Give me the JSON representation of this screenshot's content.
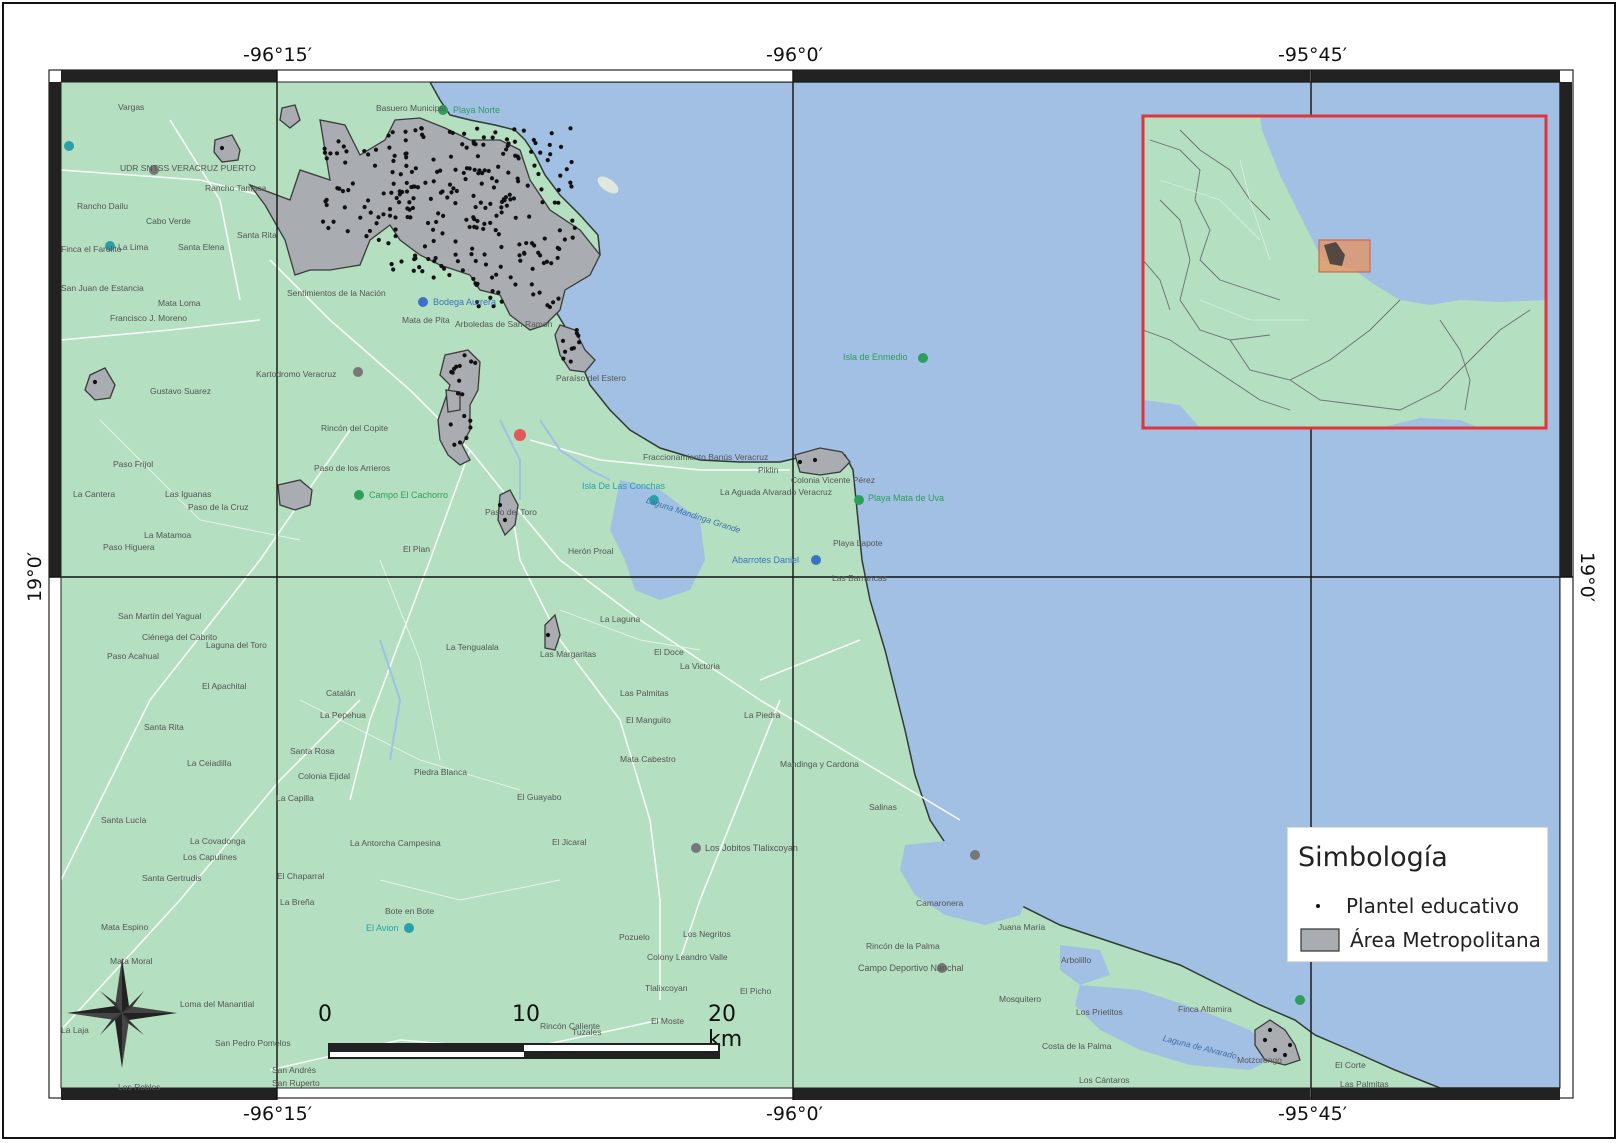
{
  "map": {
    "grid_labels": {
      "top": [
        "-96°15′",
        "-96°0′",
        "-95°45′"
      ],
      "bottom": [
        "-96°15′",
        "-96°0′",
        "-95°45′"
      ],
      "left": [
        "19°0′"
      ],
      "right": [
        "19°0′"
      ]
    },
    "colors": {
      "land": "#b4dfc0",
      "water": "#a1c0e4",
      "metro_area": "#a9acb1",
      "points": "#111111",
      "inset_border": "#e0353a",
      "inset_highlight": "#e9925f",
      "frame": "#222222"
    },
    "places": [
      {
        "name": "Vargas"
      },
      {
        "name": "UDR SNTSS VERACRUZ PUERTO"
      },
      {
        "name": "Rancho Tamaca"
      },
      {
        "name": "Rancho Dailu"
      },
      {
        "name": "Cabo Verde"
      },
      {
        "name": "Finca el Farolito"
      },
      {
        "name": "La Lima"
      },
      {
        "name": "Santa Elena"
      },
      {
        "name": "Santa Rita"
      },
      {
        "name": "San Juan de Estancia"
      },
      {
        "name": "Mata Loma"
      },
      {
        "name": "Francisco J. Moreno"
      },
      {
        "name": "Gustavo Suarez"
      },
      {
        "name": "Paso Frijol"
      },
      {
        "name": "La Cantera"
      },
      {
        "name": "Las Iguanas"
      },
      {
        "name": "Paso de la Cruz"
      },
      {
        "name": "La Matamoa"
      },
      {
        "name": "Paso Higuera"
      },
      {
        "name": "Basuero Municipal"
      },
      {
        "name": "Sentimientos de la Nación"
      },
      {
        "name": "Mata de Pita"
      },
      {
        "name": "Arboledas de San Ramon"
      },
      {
        "name": "Kartodromo Veracruz"
      },
      {
        "name": "Rincón del Copite"
      },
      {
        "name": "Paso de los Arrieros"
      },
      {
        "name": "Paraíso del Estero"
      },
      {
        "name": "Paso del Toro"
      },
      {
        "name": "El Plan"
      },
      {
        "name": "Herón Proal"
      },
      {
        "name": "Fraccionamiento Banús Veracruz"
      },
      {
        "name": "Piklin"
      },
      {
        "name": "La Aguada Alvarado Veracruz"
      },
      {
        "name": "Colonia Vicente Pérez"
      },
      {
        "name": "Playa Lapote"
      },
      {
        "name": "Las Barrancas"
      },
      {
        "name": "San Martín del Yagual"
      },
      {
        "name": "Ciénega del Cabrito"
      },
      {
        "name": "Laguna del Toro"
      },
      {
        "name": "Paso Acahual"
      },
      {
        "name": "El Apachital"
      },
      {
        "name": "Catalán"
      },
      {
        "name": "La Pepehua"
      },
      {
        "name": "Santa Rita"
      },
      {
        "name": "Santa Rosa"
      },
      {
        "name": "La Ceiadilla"
      },
      {
        "name": "Colonia Ejidal"
      },
      {
        "name": "Piedra Blanca"
      },
      {
        "name": "La Capilla"
      },
      {
        "name": "Santa Lucía"
      },
      {
        "name": "La Covadonga"
      },
      {
        "name": "Los Capulines"
      },
      {
        "name": "Santa Gertrudis"
      },
      {
        "name": "El Chaparral"
      },
      {
        "name": "La Breña"
      },
      {
        "name": "La Antorcha Campesina"
      },
      {
        "name": "El Guayabo"
      },
      {
        "name": "El Jicaral"
      },
      {
        "name": "Mata Espino"
      },
      {
        "name": "Mata Moral"
      },
      {
        "name": "Loma del Manantial"
      },
      {
        "name": "La Laja"
      },
      {
        "name": "San Pedro Pomelos"
      },
      {
        "name": "San Andrés"
      },
      {
        "name": "San Ruperto"
      },
      {
        "name": "Los Robles"
      },
      {
        "name": "Bote en Bote"
      },
      {
        "name": "La Tengualala"
      },
      {
        "name": "Las Margaritas"
      },
      {
        "name": "La Laguna"
      },
      {
        "name": "El Doce"
      },
      {
        "name": "La Victoria"
      },
      {
        "name": "Las Palmitas"
      },
      {
        "name": "El Manguito"
      },
      {
        "name": "La Piedra"
      },
      {
        "name": "Mata Cabestro"
      },
      {
        "name": "Mandinga y Cardona"
      },
      {
        "name": "Salinas"
      },
      {
        "name": "Pozuelo"
      },
      {
        "name": "Colony Leandro Valle"
      },
      {
        "name": "Tlalixcoyan"
      },
      {
        "name": "Los Negritos"
      },
      {
        "name": "El Picho"
      },
      {
        "name": "El Moste"
      },
      {
        "name": "Rincón Caliente"
      },
      {
        "name": "Tuzales"
      },
      {
        "name": "Rincón de la Palma"
      },
      {
        "name": "Juana María"
      },
      {
        "name": "Arbolillo"
      },
      {
        "name": "Mosquitero"
      },
      {
        "name": "Los Prietitos"
      },
      {
        "name": "Costa de la Palma"
      },
      {
        "name": "Finca Altamira"
      },
      {
        "name": "Motzorongo"
      },
      {
        "name": "El Corte"
      },
      {
        "name": "Los Cántaros"
      },
      {
        "name": "Las Palmitas"
      },
      {
        "name": "Camaronera"
      },
      {
        "name": "Laguna de Alvarado"
      },
      {
        "name": "Laguna Mandinga Grande"
      }
    ],
    "pois": [
      {
        "name": "Playa Norte",
        "color": "#2e9e5b"
      },
      {
        "name": "Bodega Aurrera",
        "color": "#3b73c4"
      },
      {
        "name": "Isla de Enmedio",
        "color": "#2e9e5b"
      },
      {
        "name": "Isla De Las Conchas",
        "color": "#2aa0a8"
      },
      {
        "name": "Campo El Cachorro",
        "color": "#2e9e5b"
      },
      {
        "name": "Playa Mata de Uva",
        "color": "#2e9e5b"
      },
      {
        "name": "Abarrotes Daniel",
        "color": "#3b73c4"
      },
      {
        "name": "Los Jobitos Tlalixcoyan",
        "color": "#555555"
      },
      {
        "name": "El Avion",
        "color": "#2aa0a8"
      },
      {
        "name": "Campo Deportivo Nanchal",
        "color": "#555555"
      }
    ]
  },
  "legend": {
    "title": "Simbología",
    "items": [
      {
        "label": "Plantel educativo",
        "symbol": "point"
      },
      {
        "label": "Área Metropolitana",
        "symbol": "polygon"
      }
    ]
  },
  "scale_bar": {
    "labels": [
      "0",
      "10",
      "20 km"
    ]
  },
  "north_arrow": {
    "icon": "compass-rose-icon"
  }
}
